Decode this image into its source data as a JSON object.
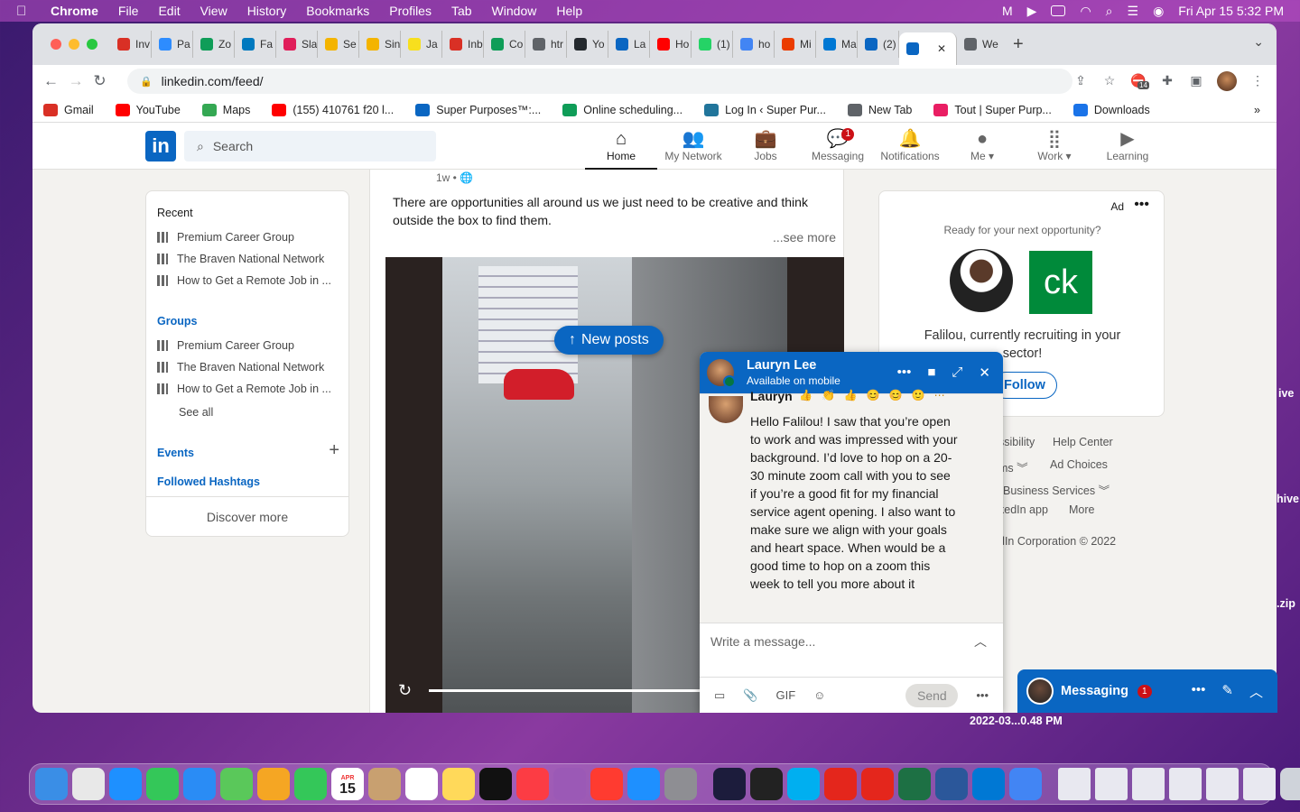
{
  "menubar": {
    "app": "Chrome",
    "items": [
      "File",
      "Edit",
      "View",
      "History",
      "Bookmarks",
      "Profiles",
      "Tab",
      "Window",
      "Help"
    ],
    "clock": "Fri Apr 15  5:32 PM"
  },
  "browser": {
    "tabs": [
      {
        "label": "Inv",
        "color": "#d93025"
      },
      {
        "label": "Pa",
        "color": "#2d8cff"
      },
      {
        "label": "Zo",
        "color": "#0f9d58"
      },
      {
        "label": "Fa",
        "color": "#0079bf"
      },
      {
        "label": "Sla",
        "color": "#e01e5a"
      },
      {
        "label": "Se",
        "color": "#f4b400"
      },
      {
        "label": "Sin",
        "color": "#f4b400"
      },
      {
        "label": "Ja",
        "color": "#f7df1e"
      },
      {
        "label": "Inb",
        "color": "#d93025"
      },
      {
        "label": "Co",
        "color": "#0f9d58"
      },
      {
        "label": "htr",
        "color": "#5f6368"
      },
      {
        "label": "Yo",
        "color": "#24292e"
      },
      {
        "label": "La",
        "color": "#0a66c2"
      },
      {
        "label": "Ho",
        "color": "#ff0000"
      },
      {
        "label": "(1)",
        "color": "#25d366"
      },
      {
        "label": "ho",
        "color": "#4285f4"
      },
      {
        "label": "Mi",
        "color": "#eb3c00"
      },
      {
        "label": "Ma",
        "color": "#0078d4"
      },
      {
        "label": "(2)",
        "color": "#0a66c2"
      }
    ],
    "active_tab": {
      "label": "",
      "color": "#0a66c2"
    },
    "last_tab": {
      "label": "We",
      "color": "#5f6368"
    },
    "url": "linkedin.com/feed/",
    "extension_badge": "14"
  },
  "bookmarks": [
    {
      "label": "Gmail",
      "color": "#d93025"
    },
    {
      "label": "YouTube",
      "color": "#ff0000"
    },
    {
      "label": "Maps",
      "color": "#34a853"
    },
    {
      "label": "(155) 410761 f20 l...",
      "color": "#ff0000"
    },
    {
      "label": "Super Purposes™:...",
      "color": "#0a66c2"
    },
    {
      "label": "Online scheduling...",
      "color": "#0f9d58"
    },
    {
      "label": "Log In ‹ Super Pur...",
      "color": "#21759b"
    },
    {
      "label": "New Tab",
      "color": "#5f6368"
    },
    {
      "label": "Tout | Super Purp...",
      "color": "#e91e63"
    },
    {
      "label": "Downloads",
      "color": "#1a73e8"
    }
  ],
  "linkedin": {
    "logo": "in",
    "search_placeholder": "Search",
    "nav": [
      {
        "label": "Home",
        "icon": "home-icon",
        "glyph": "⌂",
        "badge": ""
      },
      {
        "label": "My Network",
        "icon": "network-icon",
        "glyph": "👥",
        "badge": ""
      },
      {
        "label": "Jobs",
        "icon": "jobs-icon",
        "glyph": "💼",
        "badge": ""
      },
      {
        "label": "Messaging",
        "icon": "messaging-icon",
        "glyph": "💬",
        "badge": "1"
      },
      {
        "label": "Notifications",
        "icon": "bell-icon",
        "glyph": "🔔",
        "badge": ""
      },
      {
        "label": "Me ▾",
        "icon": "me-avatar-icon",
        "glyph": "●",
        "badge": ""
      },
      {
        "label": "Work ▾",
        "icon": "grid-icon",
        "glyph": "⣿",
        "badge": ""
      },
      {
        "label": "Learning",
        "icon": "learning-icon",
        "glyph": "▶",
        "badge": ""
      }
    ],
    "left": {
      "recent_title": "Recent",
      "recent": [
        "Premium Career Group",
        "The Braven National Network",
        "How to Get a Remote Job in ..."
      ],
      "groups_title": "Groups",
      "groups": [
        "Premium Career Group",
        "The Braven National Network",
        "How to Get a Remote Job in ..."
      ],
      "see_all": "See all",
      "events": "Events",
      "hashtags": "Followed Hashtags",
      "discover": "Discover more"
    },
    "post": {
      "time": "1w •",
      "text": "There are opportunities all around us we just need to be creative and think outside the box to find them.",
      "see_more": "...see more",
      "new_posts": "New posts"
    },
    "ad": {
      "label": "Ad",
      "question": "Ready for your next opportunity?",
      "logo_text": "ck",
      "text": "Falilou, currently recruiting in your sector!",
      "follow": "Follow"
    },
    "footer": {
      "accessibility": "ssibility",
      "help": "Help Center",
      "terms": "ms ︾",
      "adchoices": "Ad Choices",
      "business": "Business Services ︾",
      "app": "kedIn app",
      "more": "More",
      "copyright": "dIn Corporation © 2022"
    },
    "chat": {
      "name": "Lauryn Lee",
      "status": "Available on mobile",
      "sender": "Lauryn",
      "message": "Hello Falilou! I saw that you’re open to work and was impressed with your background. I’d love to hop on a 20-30 minute zoom call with you to see if you’re a good fit for my financial service agent opening. I also want to make sure we align with your goals and heart space. When would be a good time to hop on a zoom this week to tell you more about it",
      "input_placeholder": "Write a message...",
      "send": "Send"
    },
    "dock": {
      "label": "Messaging",
      "badge": "1"
    }
  },
  "desktop": {
    "labels": [
      "ive",
      "hive",
      ".zip",
      "2022-03...0.48 PM"
    ]
  },
  "macdock": {
    "apps": [
      {
        "name": "finder",
        "color": "#3a8ee6"
      },
      {
        "name": "launchpad",
        "color": "#e8e8e8"
      },
      {
        "name": "safari",
        "color": "#1e90ff"
      },
      {
        "name": "messages",
        "color": "#34c759"
      },
      {
        "name": "mail",
        "color": "#2a8cf5"
      },
      {
        "name": "maps",
        "color": "#5ac85a"
      },
      {
        "name": "photos",
        "color": "#f5a623"
      },
      {
        "name": "facetime",
        "color": "#34c759"
      },
      {
        "name": "calendar",
        "color": "#ffffff"
      },
      {
        "name": "contacts",
        "color": "#c8a070"
      },
      {
        "name": "reminders",
        "color": "#ffffff"
      },
      {
        "name": "notes",
        "color": "#ffd95a"
      },
      {
        "name": "tv",
        "color": "#111111"
      },
      {
        "name": "music",
        "color": "#fc3c44"
      },
      {
        "name": "podcasts",
        "color": "#9b59b6"
      },
      {
        "name": "news",
        "color": "#ff3b30"
      },
      {
        "name": "appstore",
        "color": "#1e90ff"
      },
      {
        "name": "settings",
        "color": "#8e8e93"
      }
    ],
    "apps2": [
      {
        "name": "app-dark",
        "color": "#1c1c3c"
      },
      {
        "name": "terminal",
        "color": "#222222"
      },
      {
        "name": "skype",
        "color": "#00aff0"
      },
      {
        "name": "acrobat",
        "color": "#e4261c"
      },
      {
        "name": "acrobat2",
        "color": "#e4261c"
      },
      {
        "name": "excel",
        "color": "#1d7044"
      },
      {
        "name": "word",
        "color": "#2b579a"
      },
      {
        "name": "vscode",
        "color": "#0078d4"
      },
      {
        "name": "chrome",
        "color": "#4285f4"
      }
    ],
    "calendar_day": "15",
    "calendar_month": "APR"
  }
}
